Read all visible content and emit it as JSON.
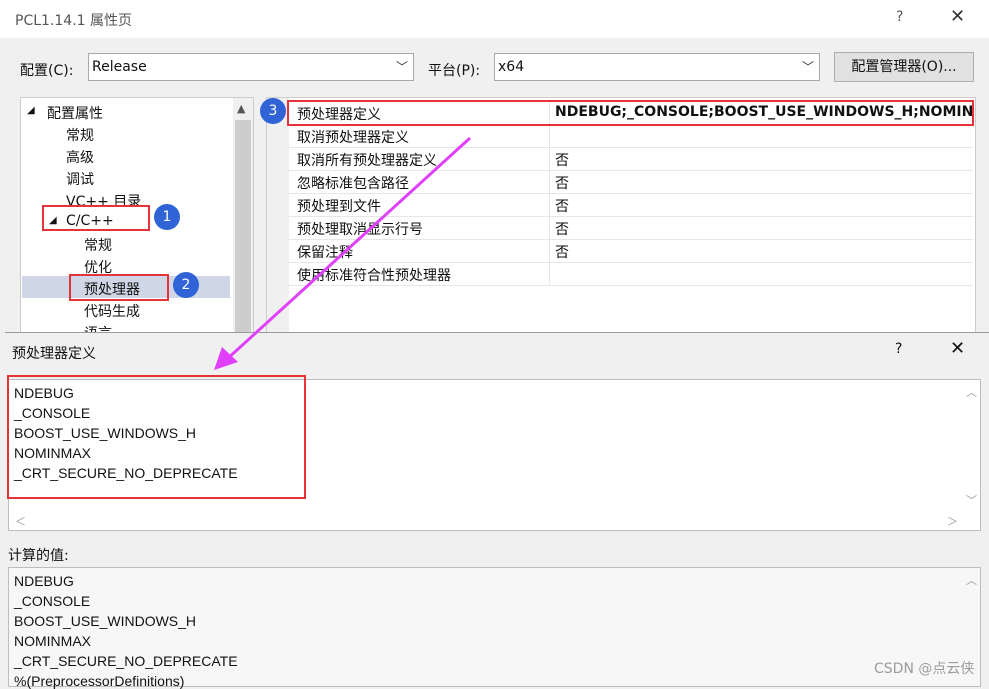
{
  "window": {
    "title": "PCL1.14.1 属性页",
    "help": "?",
    "close": "✕"
  },
  "toolbar": {
    "config_label": "配置(C):",
    "config_value": "Release",
    "platform_label": "平台(P):",
    "platform_value": "x64",
    "config_manager": "配置管理器(O)..."
  },
  "tree": {
    "items": [
      {
        "label": "配置属性",
        "expander": "◢"
      },
      {
        "label": "常规"
      },
      {
        "label": "高级"
      },
      {
        "label": "调试"
      },
      {
        "label": "VC++ 目录"
      },
      {
        "label": "C/C++",
        "expander": "◢"
      },
      {
        "label": "常规"
      },
      {
        "label": "优化"
      },
      {
        "label": "预处理器"
      },
      {
        "label": "代码生成"
      },
      {
        "label": "语言"
      }
    ],
    "scroll_up": "▲"
  },
  "grid": {
    "rows": [
      {
        "name": "预处理器定义",
        "value": "NDEBUG;_CONSOLE;BOOST_USE_WINDOWS_H;NOMIN"
      },
      {
        "name": "取消预处理器定义",
        "value": ""
      },
      {
        "name": "取消所有预处理器定义",
        "value": "否"
      },
      {
        "name": "忽略标准包含路径",
        "value": "否"
      },
      {
        "name": "预处理到文件",
        "value": "否"
      },
      {
        "name": "预处理取消显示行号",
        "value": "否"
      },
      {
        "name": "保留注释",
        "value": "否"
      },
      {
        "name": "使用标准符合性预处理器",
        "value": ""
      }
    ]
  },
  "badges": [
    "1",
    "2",
    "3"
  ],
  "dialog": {
    "title": "预处理器定义",
    "help": "?",
    "close": "✕",
    "definitions": [
      "NDEBUG",
      "_CONSOLE",
      "BOOST_USE_WINDOWS_H",
      "NOMINMAX",
      "_CRT_SECURE_NO_DEPRECATE"
    ],
    "computed_label": "计算的值:",
    "computed": [
      "NDEBUG",
      "_CONSOLE",
      "BOOST_USE_WINDOWS_H",
      "NOMINMAX",
      "_CRT_SECURE_NO_DEPRECATE",
      "%(PreprocessorDefinitions)"
    ]
  },
  "watermark": "CSDN @点云侠",
  "colors": {
    "highlight_red": "#e5333a",
    "badge_blue": "#2f63d6",
    "arrow_magenta": "#e040fb"
  }
}
